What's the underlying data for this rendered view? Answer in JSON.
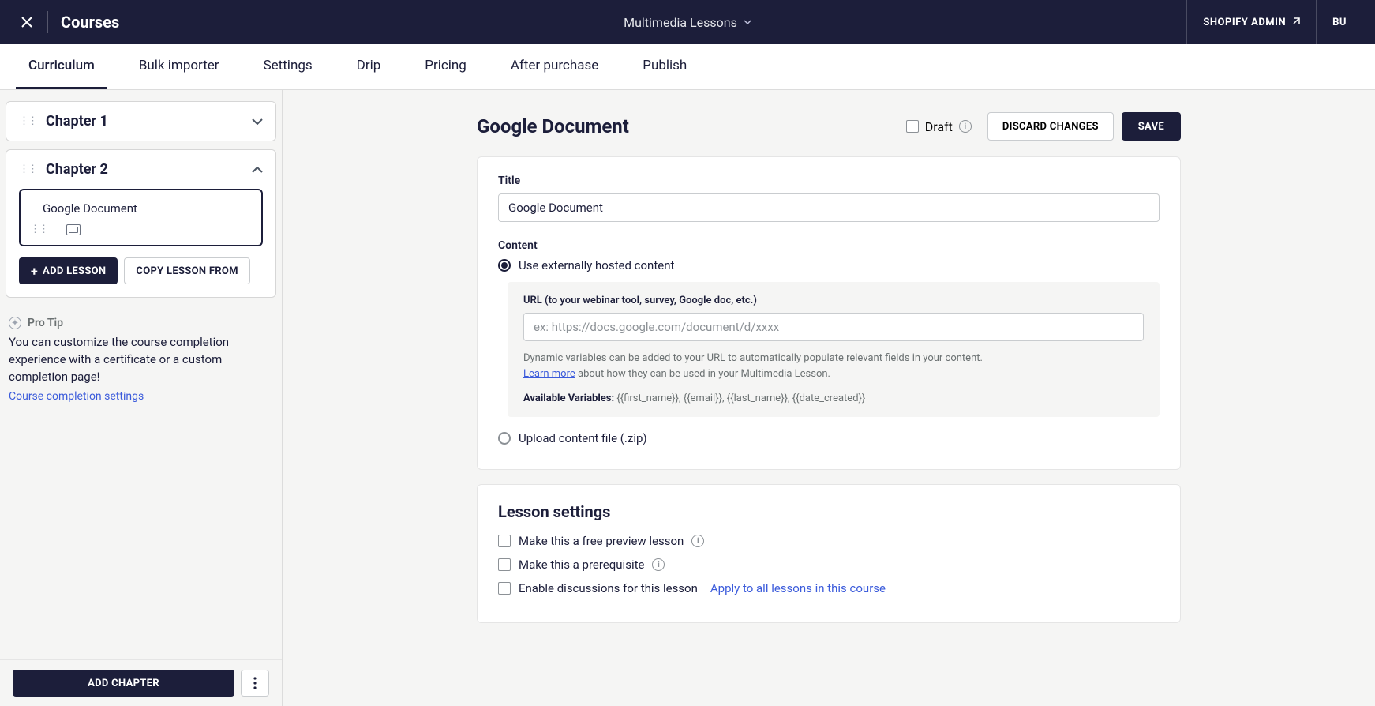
{
  "topbar": {
    "title": "Courses",
    "lesson_name": "Multimedia Lessons",
    "shopify": "SHOPIFY ADMIN",
    "right2": "BU"
  },
  "tabs": [
    "Curriculum",
    "Bulk importer",
    "Settings",
    "Drip",
    "Pricing",
    "After purchase",
    "Publish"
  ],
  "active_tab_index": 0,
  "chapters": [
    {
      "title": "Chapter 1",
      "expanded": false
    },
    {
      "title": "Chapter 2",
      "expanded": true,
      "lessons": [
        {
          "title": "Google Document"
        }
      ]
    }
  ],
  "sidebar_buttons": {
    "add_lesson": "ADD LESSON",
    "copy_lesson": "COPY LESSON FROM"
  },
  "protip": {
    "label": "Pro Tip",
    "text": "You can customize the course completion experience with a certificate or a custom completion page!",
    "link": "Course completion settings"
  },
  "footer": {
    "add_chapter": "ADD CHAPTER"
  },
  "page": {
    "heading": "Google Document",
    "draft_label": "Draft",
    "discard": "DISCARD CHANGES",
    "save": "SAVE"
  },
  "form": {
    "title_label": "Title",
    "title_value": "Google Document",
    "content_label": "Content",
    "radio_external": "Use externally hosted content",
    "radio_upload": "Upload content file (.zip)",
    "url_label": "URL (to your webinar tool, survey, Google doc, etc.)",
    "url_placeholder": "ex: https://docs.google.com/document/d/xxxx",
    "helper1": "Dynamic variables can be added to your URL to automatically populate relevant fields in your content.",
    "learn_more": "Learn more",
    "helper2": " about how they can be used in your Multimedia Lesson.",
    "vars_label": "Available Variables:",
    "vars_list": " {{first_name}}, {{email}}, {{last_name}}, {{date_created}}"
  },
  "settings": {
    "heading": "Lesson settings",
    "free_preview": "Make this a free preview lesson",
    "prerequisite": "Make this a prerequisite",
    "discussions": "Enable discussions for this lesson",
    "apply_all": "Apply to all lessons in this course"
  }
}
